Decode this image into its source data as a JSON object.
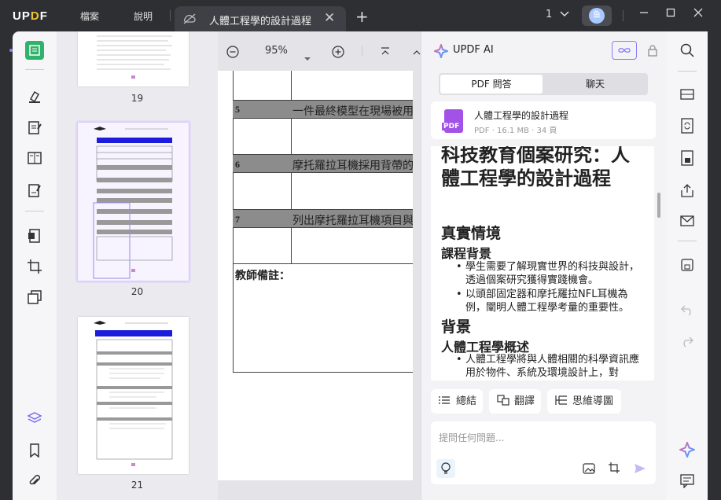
{
  "titlebar": {
    "logo": "UPDF",
    "menu": [
      "檔案",
      "說明"
    ],
    "tab_title": "人體工程學的設計過程",
    "tab_close": "✕",
    "add_tab": "+",
    "page_indicator": "1",
    "avatar_initial": "鱼"
  },
  "thumbnails": {
    "labels": [
      "19",
      "20",
      "21"
    ]
  },
  "toolbar": {
    "zoom": "95%"
  },
  "document": {
    "rows": [
      {
        "num": "5",
        "text": "一件最終模型在現場被用"
      },
      {
        "num": "6",
        "text": "摩托羅拉耳機採用背帶的"
      },
      {
        "num": "7",
        "text": "列出摩托羅拉耳機項目與"
      }
    ],
    "notes_label": "教師備註："
  },
  "ai_panel": {
    "title": "UPDF AI",
    "tabs": [
      "PDF 問答",
      "聊天"
    ],
    "file": {
      "name": "人體工程學的設計過程",
      "meta": "PDF · 16.1 MB · 34 頁",
      "badge": "PDF"
    },
    "content": {
      "heading": "科技教育個案研究：人體工程學的設計過程",
      "sec1": "真實情境",
      "sub1": "課程背景",
      "bullets1": [
        "學生需要了解現實世界的科技與設計，透過個案研究獲得實踐機會。",
        "以頭部固定器和摩托羅拉NFL耳機為例，闡明人體工程學考量的重要性。"
      ],
      "sec2": "背景",
      "sub2": "人體工程學概述",
      "bullets2": [
        "人體工程學將與人體相關的科學資訊應用於物件、系統及環境設計上，對"
      ]
    },
    "actions": [
      "總結",
      "翻譯",
      "思維導圖"
    ],
    "input_placeholder": "提問任何問題..."
  },
  "colors": {
    "accent": "#8a7cf7",
    "table_gray": "#8c8c8c",
    "dark": "#2e2f33"
  }
}
